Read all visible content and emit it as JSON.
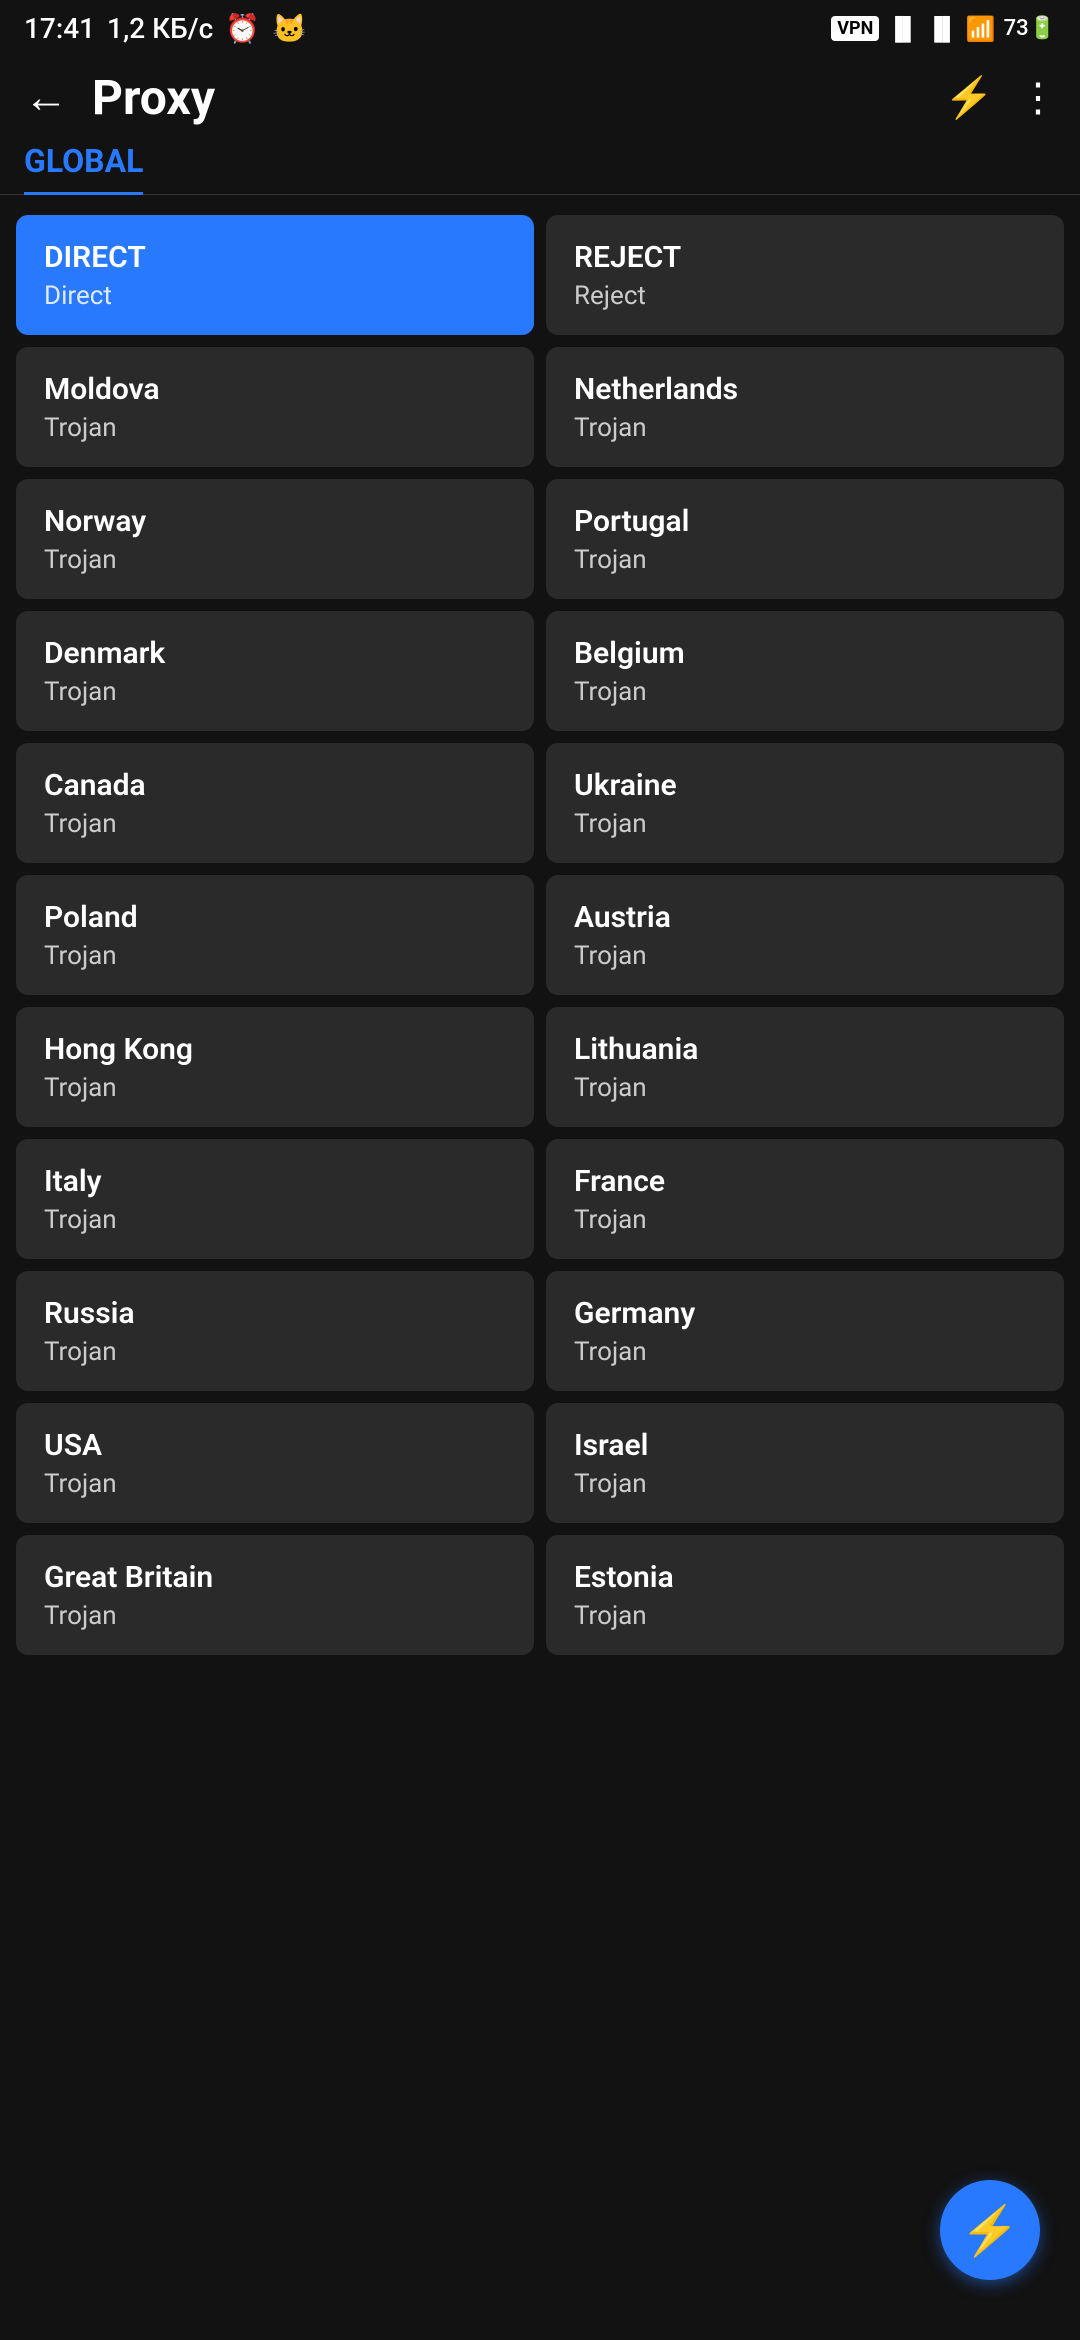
{
  "statusBar": {
    "time": "17:41",
    "speed": "1,2 КБ/с",
    "vpnLabel": "VPN",
    "batteryLevel": "73"
  },
  "appBar": {
    "title": "Proxy",
    "backLabel": "←",
    "boltLabel": "⚡",
    "moreLabel": "⋮"
  },
  "tabs": {
    "label": "GLOBAL"
  },
  "proxyItems": [
    {
      "name": "DIRECT",
      "type": "Direct",
      "selected": true
    },
    {
      "name": "REJECT",
      "type": "Reject",
      "selected": false
    },
    {
      "name": "Moldova",
      "type": "Trojan",
      "selected": false
    },
    {
      "name": "Netherlands",
      "type": "Trojan",
      "selected": false
    },
    {
      "name": "Norway",
      "type": "Trojan",
      "selected": false
    },
    {
      "name": "Portugal",
      "type": "Trojan",
      "selected": false
    },
    {
      "name": "Denmark",
      "type": "Trojan",
      "selected": false
    },
    {
      "name": "Belgium",
      "type": "Trojan",
      "selected": false
    },
    {
      "name": "Canada",
      "type": "Trojan",
      "selected": false
    },
    {
      "name": "Ukraine",
      "type": "Trojan",
      "selected": false
    },
    {
      "name": "Poland",
      "type": "Trojan",
      "selected": false
    },
    {
      "name": "Austria",
      "type": "Trojan",
      "selected": false
    },
    {
      "name": "Hong Kong",
      "type": "Trojan",
      "selected": false
    },
    {
      "name": "Lithuania",
      "type": "Trojan",
      "selected": false
    },
    {
      "name": "Italy",
      "type": "Trojan",
      "selected": false
    },
    {
      "name": "France",
      "type": "Trojan",
      "selected": false
    },
    {
      "name": "Russia",
      "type": "Trojan",
      "selected": false
    },
    {
      "name": "Germany",
      "type": "Trojan",
      "selected": false
    },
    {
      "name": "USA",
      "type": "Trojan",
      "selected": false
    },
    {
      "name": "Israel",
      "type": "Trojan",
      "selected": false
    },
    {
      "name": "Great Britain",
      "type": "Trojan",
      "selected": false
    },
    {
      "name": "Estonia",
      "type": "Trojan",
      "selected": false
    }
  ],
  "fab": {
    "boltLabel": "⚡"
  }
}
